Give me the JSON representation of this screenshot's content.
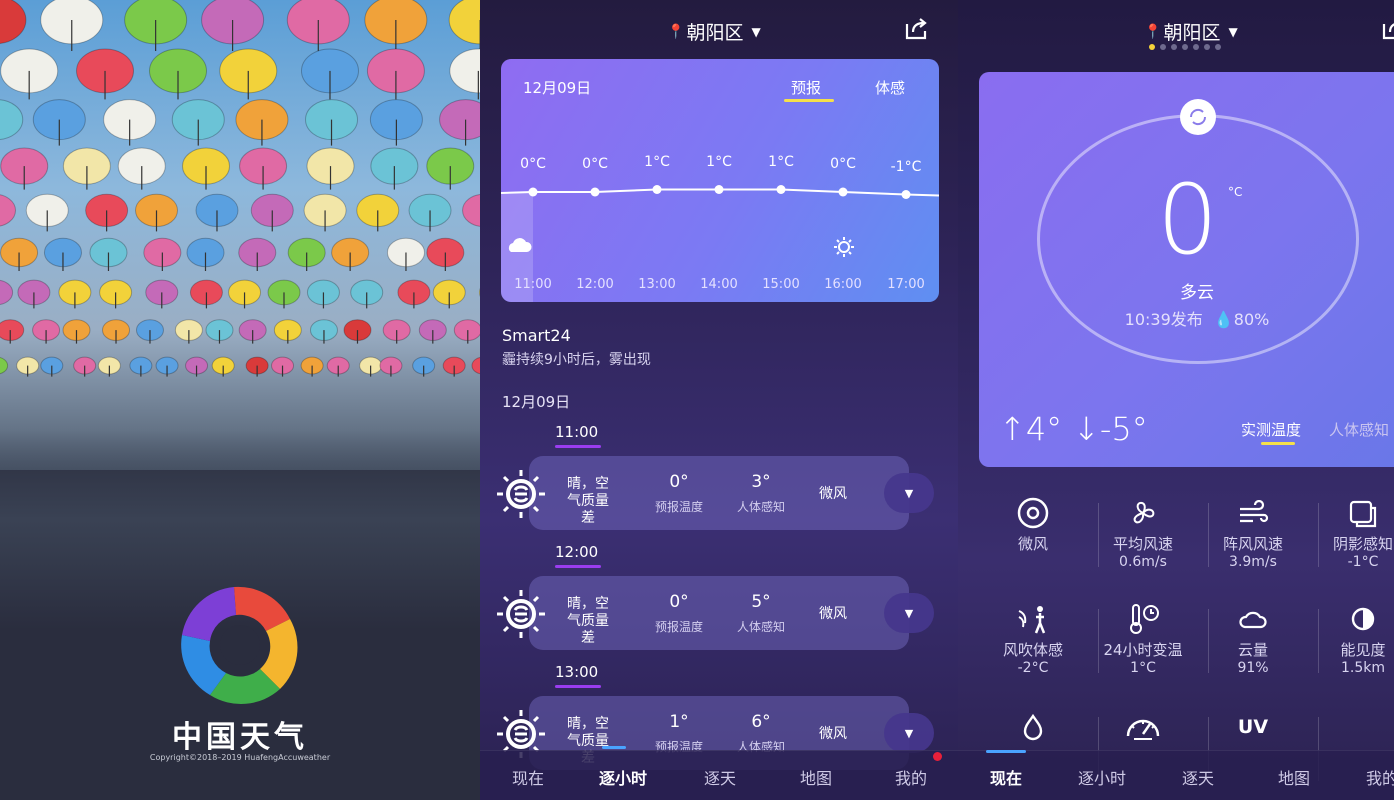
{
  "splash": {
    "app_name": "中国天气",
    "copyright": "Copyright©2018–2019 HuafengAccuweather",
    "logo_colors": [
      "#7d3fd6",
      "#e84a3c",
      "#f4b52e",
      "#3fae4a",
      "#2f8de4"
    ]
  },
  "hourly": {
    "location": "朝阳区",
    "forecast_card": {
      "date": "12月09日",
      "tabs": [
        "预报",
        "体感"
      ],
      "active_tab": "预报",
      "temps": [
        "0°C",
        "0°C",
        "1°C",
        "1°C",
        "1°C",
        "0°C",
        "-1°C"
      ],
      "hours": [
        "11:00",
        "12:00",
        "13:00",
        "14:00",
        "15:00",
        "16:00",
        "17:00"
      ],
      "weather_icons": [
        {
          "hour": "11:00",
          "icon": "cloud-icon"
        },
        {
          "hour": "16:00",
          "icon": "sun-icon"
        }
      ]
    },
    "smart_title": "Smart24",
    "smart_desc": "霾持续9小时后，雾出现",
    "day_label": "12月09日",
    "rows": [
      {
        "hour": "11:00",
        "condition": "晴，空气质量差",
        "forecast_temp": "0°",
        "forecast_label": "预报温度",
        "feels_temp": "3°",
        "feels_label": "人体感知",
        "wind": "微风"
      },
      {
        "hour": "12:00",
        "condition": "晴，空气质量差",
        "forecast_temp": "0°",
        "forecast_label": "预报温度",
        "feels_temp": "5°",
        "feels_label": "人体感知",
        "wind": "微风"
      },
      {
        "hour": "13:00",
        "condition": "晴，空气质量差",
        "forecast_temp": "1°",
        "forecast_label": "预报温度",
        "feels_temp": "6°",
        "feels_label": "人体感知",
        "wind": "微风"
      }
    ],
    "nav": [
      "现在",
      "逐小时",
      "逐天",
      "地图",
      "我的"
    ],
    "nav_active": "逐小时"
  },
  "now": {
    "location": "朝阳区",
    "page_dots": 7,
    "active_dot": 1,
    "temperature": "0",
    "unit": "°C",
    "condition": "多云",
    "published": "10:39发布",
    "humidity": "80%",
    "high": "↑4°",
    "low": "↓-5°",
    "tabs": [
      "实测温度",
      "人体感知"
    ],
    "active_tab": "实测温度",
    "grid": [
      {
        "icon": "compass-icon",
        "label": "微风",
        "value": ""
      },
      {
        "icon": "fan-icon",
        "label": "平均风速",
        "value": "0.6m/s"
      },
      {
        "icon": "gust-icon",
        "label": "阵风风速",
        "value": "3.9m/s"
      },
      {
        "icon": "shade-icon",
        "label": "阴影感知",
        "value": "-1°C"
      },
      {
        "icon": "wind-chill-icon",
        "label": "风吹体感",
        "value": "-2°C"
      },
      {
        "icon": "thermometer-clock-icon",
        "label": "24小时变温",
        "value": "1°C"
      },
      {
        "icon": "cloud-icon",
        "label": "云量",
        "value": "91%"
      },
      {
        "icon": "visibility-icon",
        "label": "能见度",
        "value": "1.5km"
      },
      {
        "icon": "drop-icon",
        "label": "",
        "value": ""
      },
      {
        "icon": "gauge-icon",
        "label": "",
        "value": ""
      },
      {
        "icon": "uv-icon",
        "label": "UV",
        "value": ""
      }
    ],
    "nav": [
      "现在",
      "逐小时",
      "逐天",
      "地图",
      "我的"
    ],
    "nav_active": "现在"
  },
  "colors": {
    "accent_yellow": "#f5e04a",
    "accent_purple": "#9a3df0",
    "nav_blue": "#4aa3ff",
    "alert_red": "#e8203a"
  }
}
